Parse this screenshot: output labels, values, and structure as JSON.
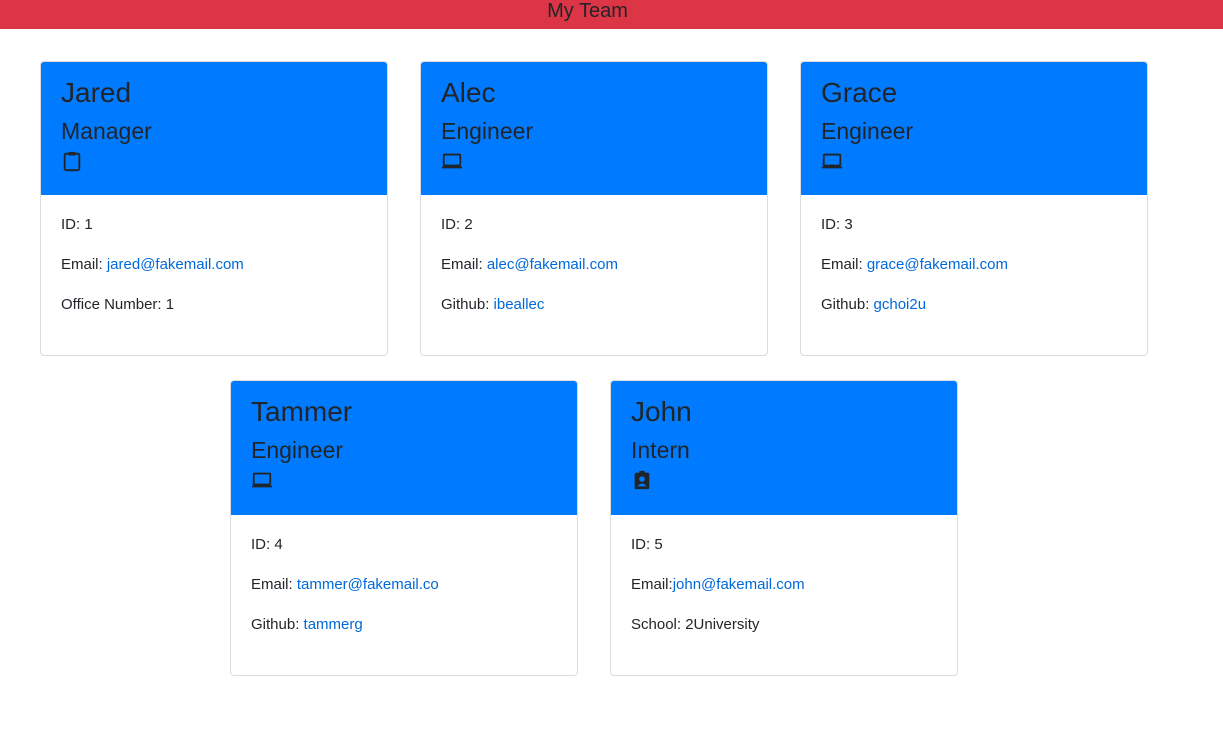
{
  "header": {
    "title": "My Team",
    "bg_color": "#dc3545"
  },
  "card_header_color": "#007bff",
  "members": [
    {
      "name": "Jared",
      "role": "Manager",
      "icon": "clipboard-icon",
      "id_text": "ID: 1",
      "email_label": "Email: ",
      "email": "jared@fakemail.com",
      "extra_label": "Office Number: 1",
      "extra_link": ""
    },
    {
      "name": "Alec",
      "role": "Engineer",
      "icon": "laptop-icon",
      "id_text": "ID: 2",
      "email_label": "Email: ",
      "email": "alec@fakemail.com",
      "extra_label": "Github: ",
      "extra_link": "ibeallec"
    },
    {
      "name": "Grace",
      "role": "Engineer",
      "icon": "laptop-icon",
      "id_text": "ID: 3",
      "email_label": "Email: ",
      "email": "grace@fakemail.com",
      "extra_label": "Github: ",
      "extra_link": "gchoi2u"
    },
    {
      "name": "Tammer",
      "role": "Engineer",
      "icon": "laptop-icon",
      "id_text": "ID: 4",
      "email_label": "Email: ",
      "email": "tammer@fakemail.co",
      "extra_label": "Github: ",
      "extra_link": "tammerg"
    },
    {
      "name": "John",
      "role": "Intern",
      "icon": "student-badge-icon",
      "id_text": "ID: 5",
      "email_label": "Email:",
      "email": "john@fakemail.com",
      "extra_label": "School: 2University",
      "extra_link": ""
    }
  ]
}
